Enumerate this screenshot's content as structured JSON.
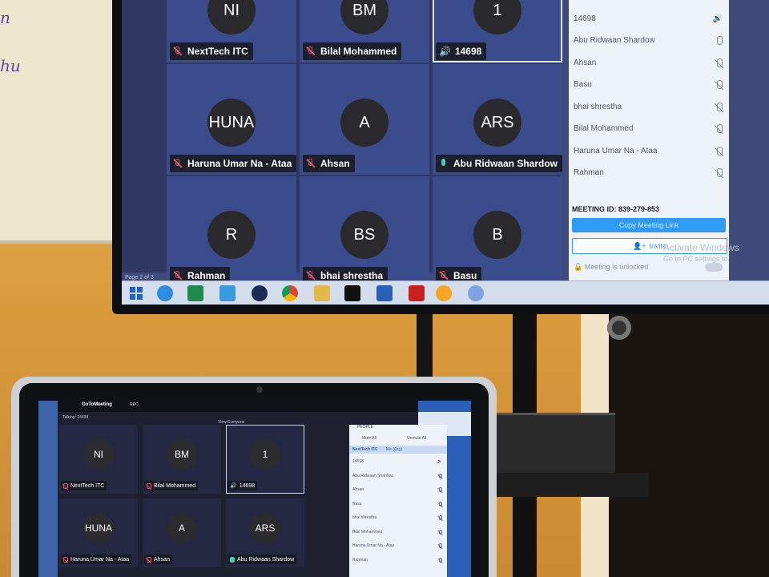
{
  "whiteboard": {
    "scrawl1": "n",
    "scrawl2": "hu"
  },
  "tv": {
    "tiles": [
      {
        "initials": "NI",
        "name": "NextTech ITC",
        "mic": "muted"
      },
      {
        "initials": "BM",
        "name": "Bilal Mohammed",
        "mic": "muted"
      },
      {
        "initials": "1",
        "name": "14698",
        "mic": "speaking"
      },
      {
        "initials": "HUNA",
        "name": "Haruna Umar Na - Ataa",
        "mic": "muted"
      },
      {
        "initials": "A",
        "name": "Ahsan",
        "mic": "muted"
      },
      {
        "initials": "ARS",
        "name": "Abu Ridwaan Shardow",
        "mic": "live"
      },
      {
        "initials": "R",
        "name": "Rahman",
        "mic": "muted"
      },
      {
        "initials": "BS",
        "name": "bhai shrestha",
        "mic": "muted"
      },
      {
        "initials": "B",
        "name": "Basu",
        "mic": "muted"
      }
    ],
    "page_label": "Page 2 of 3",
    "people": [
      "14698",
      "Abu Ridwaan Shardow",
      "Ahsan",
      "Basu",
      "bhai shrestha",
      "Bilal Mohammed",
      "Haruna Umar Na - Ataa",
      "Rahman"
    ],
    "meeting_id_label": "MEETING ID:",
    "meeting_id": "839-279-853",
    "copy_link": "Copy Meeting Link",
    "invite": "Invite",
    "unlocked": "Meeting is unlocked",
    "activate1": "Activate Windows",
    "activate2": "Go to PC settings to"
  },
  "laptop": {
    "app_title": "GoToMeeting",
    "rec": "REC",
    "talking": "Talking: 14698",
    "view": "View Everyone",
    "people_label": "PEOPLE",
    "mute_all": "Mute All",
    "unmute_all": "Unmute All",
    "org": "NextTech ITC",
    "me": "Me (Org)",
    "tiles": [
      {
        "initials": "NI",
        "name": "NextTech ITC",
        "mic": "muted"
      },
      {
        "initials": "BM",
        "name": "Bilal Mohammed",
        "mic": "muted"
      },
      {
        "initials": "1",
        "name": "14698",
        "mic": "speaking"
      },
      {
        "initials": "HUNA",
        "name": "Haruna Umar Na - Ataa",
        "mic": "muted"
      },
      {
        "initials": "A",
        "name": "Ahsan",
        "mic": "muted"
      },
      {
        "initials": "ARS",
        "name": "Abu Ridwaan Shardow",
        "mic": "live"
      }
    ],
    "people": [
      "14698",
      "Abu Ridwaan Shardow",
      "Ahsan",
      "Basu",
      "bhai shrestha",
      "Bilal Mohammed",
      "Haruna Umar Na - Ataa",
      "Rahman"
    ]
  },
  "colors": {
    "muted": "#e8506e",
    "live": "#3fd1b5",
    "accent": "#2f9bf4"
  },
  "icons": [
    "windows-start-icon",
    "ie-icon",
    "excel-icon",
    "app-icon",
    "chrome-icon",
    "explorer-icon",
    "cmd-icon",
    "word-icon",
    "pdf-icon",
    "gotomeeting-icon"
  ]
}
